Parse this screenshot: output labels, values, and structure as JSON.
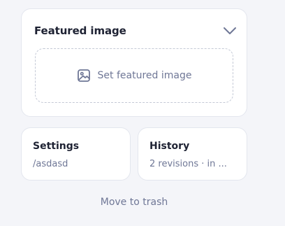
{
  "featured_image": {
    "title": "Featured image",
    "action_label": "Set featured image",
    "toggle_icon": "chevron-down-icon",
    "action_icon": "image-icon"
  },
  "settings": {
    "title": "Settings",
    "value": "/asdasd"
  },
  "history": {
    "title": "History",
    "value": "2 revisions · in ..."
  },
  "trash": {
    "label": "Move to trash"
  },
  "colors": {
    "background": "#f4f5f9",
    "card": "#ffffff",
    "border": "#e3e6ee",
    "title_text": "#1e2233",
    "muted_text": "#6f7796",
    "dashed_border": "#c4c9d6"
  }
}
